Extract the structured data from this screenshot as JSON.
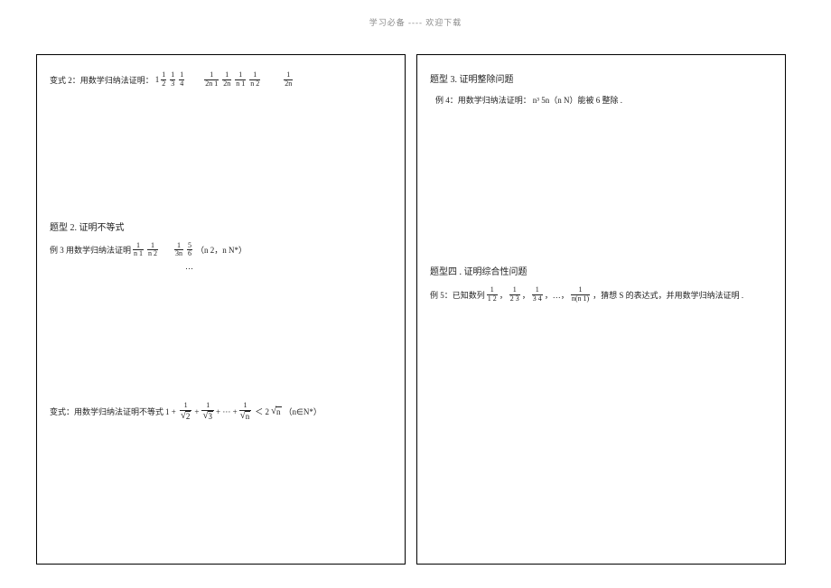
{
  "header": "学习必备 ---- 欢迎下载",
  "left": {
    "var2_label": "变式 2：用数学归纳法证明：",
    "var2_lead": "1",
    "frac_seq_a": [
      {
        "n": "1",
        "d": "2"
      },
      {
        "n": "1",
        "d": "3"
      },
      {
        "n": "1",
        "d": "4"
      }
    ],
    "frac_seq_b": [
      {
        "n": "1",
        "d": "2n 1"
      },
      {
        "n": "1",
        "d": "2n"
      },
      {
        "n": "1",
        "d": "n 1"
      },
      {
        "n": "1",
        "d": "n 2"
      }
    ],
    "frac_last": {
      "n": "1",
      "d": "2n"
    },
    "heading2": "题型 2. 证明不等式",
    "ex3_label": "例 3 用数学归纳法证明",
    "ex3_seq": [
      {
        "n": "1",
        "d": "n 1"
      },
      {
        "n": "1",
        "d": "n 2"
      }
    ],
    "ex3_dots": "…",
    "ex3_rhs_a": {
      "n": "1",
      "d": "3n"
    },
    "ex3_rhs_b": {
      "n": "5",
      "d": "6"
    },
    "ex3_cond": "（n 2，n N*）",
    "varN_label": "变式：用数学归纳法证明不等式",
    "varN_lead": "1 +",
    "varN_fracs": [
      {
        "sqrt": "2"
      },
      {
        "sqrt": "3"
      }
    ],
    "varN_dots": " + ··· + ",
    "varN_last_sqrt": "n",
    "varN_rhs_a": "＜ 2",
    "varN_rhs_sqrt": "n",
    "varN_cond": "（n∈N*）"
  },
  "right": {
    "heading3": "题型 3. 证明整除问题",
    "ex4_label": "例 4：用数学归纳法证明：",
    "ex4_body": "n³ 5n（n N）能被 6 整除 .",
    "heading4": "题型四 . 证明综合性问题",
    "ex5_label": "例 5：已知数列",
    "ex5_seq": [
      {
        "n": "1",
        "d": "1 2"
      },
      {
        "n": "1",
        "d": "2 3"
      },
      {
        "n": "1",
        "d": "3 4"
      }
    ],
    "ex5_sep": "，",
    "ex5_dots": "，…，",
    "ex5_last": {
      "n": "1",
      "d": "n(n 1)"
    },
    "ex5_tail": "，猜想 S 的表达式，并用数学归纳法证明 ."
  }
}
